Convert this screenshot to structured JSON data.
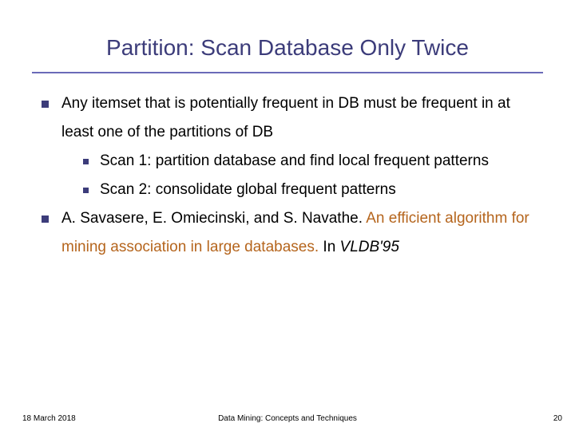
{
  "title": "Partition: Scan Database Only Twice",
  "bullets": {
    "b1": "Any itemset that is potentially frequent in DB must be frequent in at least one of the partitions of DB",
    "b1a": "Scan 1: partition database and find local frequent patterns",
    "b1b": "Scan 2: consolidate global frequent patterns",
    "b2_plain_pre": "A. Savasere, E. Omiecinski, and S. Navathe. ",
    "b2_link": "An efficient algorithm for mining association in large databases.",
    "b2_plain_post": " In ",
    "b2_ital": "VLDB'95"
  },
  "footer": {
    "date": "18 March 2018",
    "center": "Data Mining: Concepts and Techniques",
    "page": "20"
  }
}
